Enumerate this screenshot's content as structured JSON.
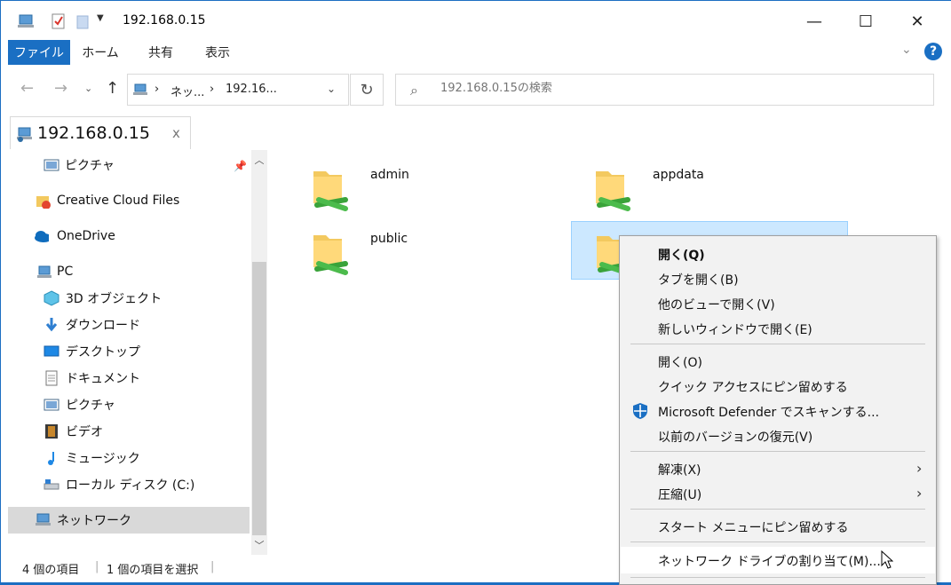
{
  "window": {
    "title": "192.168.0.15",
    "controls": {
      "minimize": "—",
      "maximize": "☐",
      "close": "✕"
    }
  },
  "ribbon": {
    "tabs": [
      "ファイル",
      "ホーム",
      "共有",
      "表示"
    ],
    "help": "?"
  },
  "address": {
    "crumbs": [
      "ネッ...",
      "192.16..."
    ],
    "search_placeholder": "192.168.0.15の検索"
  },
  "doc_tab": {
    "label": "192.168.0.15",
    "close": "x"
  },
  "sidebar": {
    "items": [
      {
        "label": "ピクチャ",
        "icon": "pictures-icon"
      },
      {
        "label": "Creative Cloud Files",
        "icon": "creative-cloud-icon"
      },
      {
        "label": "OneDrive",
        "icon": "onedrive-icon"
      },
      {
        "label": "PC",
        "icon": "pc-icon"
      },
      {
        "label": "3D オブジェクト",
        "icon": "3d-objects-icon"
      },
      {
        "label": "ダウンロード",
        "icon": "download-icon"
      },
      {
        "label": "デスクトップ",
        "icon": "desktop-icon"
      },
      {
        "label": "ドキュメント",
        "icon": "documents-icon"
      },
      {
        "label": "ピクチャ",
        "icon": "pictures-icon"
      },
      {
        "label": "ビデオ",
        "icon": "video-icon"
      },
      {
        "label": "ミュージック",
        "icon": "music-icon"
      },
      {
        "label": "ローカル ディスク (C:)",
        "icon": "local-disk-icon"
      },
      {
        "label": "ネットワーク",
        "icon": "network-icon"
      }
    ]
  },
  "content": {
    "folders": [
      {
        "name": "admin"
      },
      {
        "name": "appdata"
      },
      {
        "name": "public"
      },
      {
        "name": ""
      }
    ]
  },
  "status": {
    "count": "4 個の項目",
    "selected": "1 個の項目を選択"
  },
  "context_menu": {
    "items": [
      {
        "label": "開く(Q)",
        "bold": true
      },
      {
        "label": "タブを開く(B)"
      },
      {
        "label": "他のビューで開く(V)"
      },
      {
        "label": "新しいウィンドウで開く(E)"
      },
      {
        "label": "開く(O)"
      },
      {
        "label": "クイック アクセスにピン留めする"
      },
      {
        "label": "Microsoft Defender でスキャンする..."
      },
      {
        "label": "以前のバージョンの復元(V)"
      },
      {
        "label": "解凍(X)"
      },
      {
        "label": "圧縮(U)"
      },
      {
        "label": "スタート メニューにピン留めする"
      },
      {
        "label": "ネットワーク ドライブの割り当て(M)..."
      }
    ]
  },
  "colors": {
    "accent": "#1a6fc3",
    "selection": "#cce8ff",
    "folder": "#f3c95f",
    "share_green": "#3aa33a"
  }
}
